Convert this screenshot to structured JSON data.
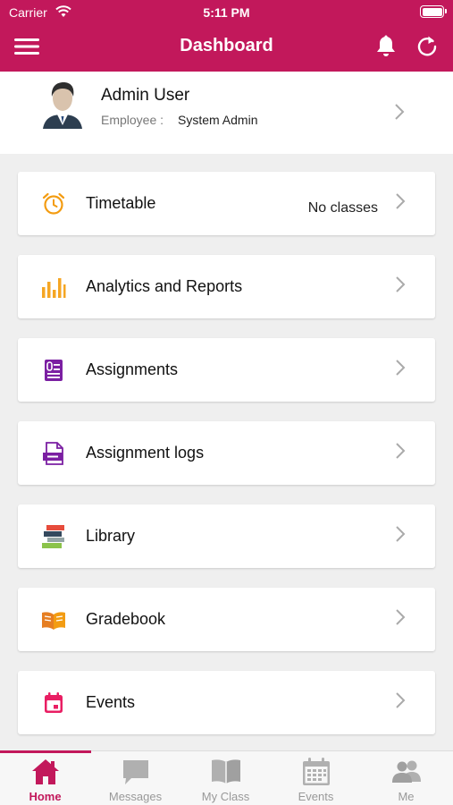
{
  "status_bar": {
    "carrier": "Carrier",
    "time": "5:11 PM"
  },
  "header": {
    "title": "Dashboard"
  },
  "profile": {
    "name": "Admin User",
    "role_label": "Employee :",
    "role_value": "System Admin"
  },
  "menu": [
    {
      "label": "Timetable",
      "value": "No classes",
      "icon": "alarm-clock-icon"
    },
    {
      "label": "Analytics and Reports",
      "icon": "bar-chart-icon"
    },
    {
      "label": "Assignments",
      "icon": "assignment-icon"
    },
    {
      "label": "Assignment logs",
      "icon": "log-file-icon"
    },
    {
      "label": "Library",
      "icon": "books-icon"
    },
    {
      "label": "Gradebook",
      "icon": "open-book-icon"
    },
    {
      "label": "Events",
      "icon": "calendar-icon"
    }
  ],
  "tabs": [
    {
      "label": "Home",
      "icon": "home-icon",
      "active": true
    },
    {
      "label": "Messages",
      "icon": "chat-icon"
    },
    {
      "label": "My Class",
      "icon": "book-icon"
    },
    {
      "label": "Events",
      "icon": "calendar-icon"
    },
    {
      "label": "Me",
      "icon": "people-icon"
    }
  ],
  "colors": {
    "accent": "#c2185b",
    "timetable": "#f39c12",
    "analytics": "#f5a623",
    "assignments": "#7b1fa2",
    "gradebook": "#e67e22",
    "events": "#e91e63"
  }
}
